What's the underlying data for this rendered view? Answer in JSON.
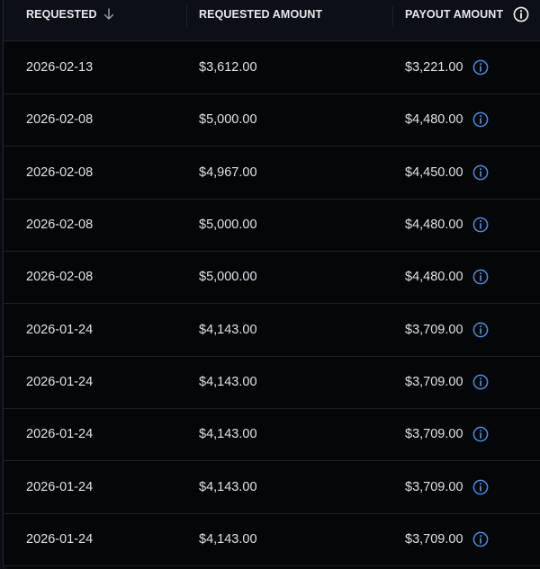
{
  "header": {
    "requested_label": "REQUESTED",
    "requested_amount_label": "REQUESTED AMOUNT",
    "payout_amount_label": "PAYOUT AMOUNT",
    "sort_icon": "arrow-down-icon",
    "info_icon": "info-circle-icon"
  },
  "rows": [
    {
      "requested": "2026-02-13",
      "requested_amount": "$3,612.00",
      "payout_amount": "$3,221.00"
    },
    {
      "requested": "2026-02-08",
      "requested_amount": "$5,000.00",
      "payout_amount": "$4,480.00"
    },
    {
      "requested": "2026-02-08",
      "requested_amount": "$4,967.00",
      "payout_amount": "$4,450.00"
    },
    {
      "requested": "2026-02-08",
      "requested_amount": "$5,000.00",
      "payout_amount": "$4,480.00"
    },
    {
      "requested": "2026-02-08",
      "requested_amount": "$5,000.00",
      "payout_amount": "$4,480.00"
    },
    {
      "requested": "2026-01-24",
      "requested_amount": "$4,143.00",
      "payout_amount": "$3,709.00"
    },
    {
      "requested": "2026-01-24",
      "requested_amount": "$4,143.00",
      "payout_amount": "$3,709.00"
    },
    {
      "requested": "2026-01-24",
      "requested_amount": "$4,143.00",
      "payout_amount": "$3,709.00"
    },
    {
      "requested": "2026-01-24",
      "requested_amount": "$4,143.00",
      "payout_amount": "$3,709.00"
    },
    {
      "requested": "2026-01-24",
      "requested_amount": "$4,143.00",
      "payout_amount": "$3,709.00"
    }
  ],
  "colors": {
    "background": "#050608",
    "header_background": "#0c0f15",
    "text": "#dfe2e7",
    "info_icon_accent": "#4a8fe0",
    "row_divider": "#1a202b"
  }
}
